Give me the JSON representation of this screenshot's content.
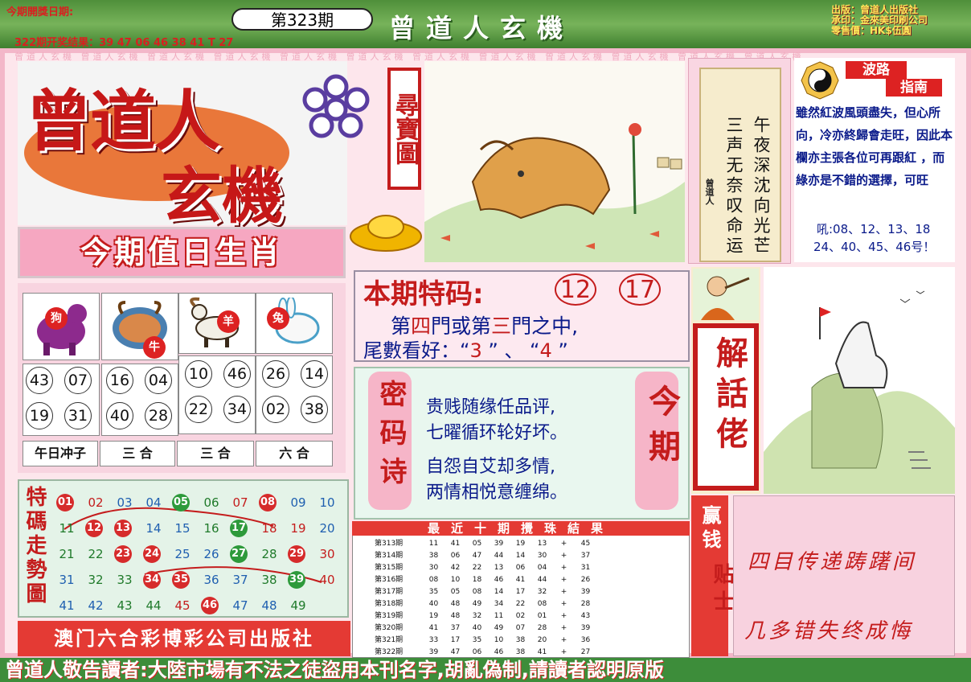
{
  "header": {
    "issue_date_label": "今期開獎日期:",
    "prev_result": "322期开奖结果：39 47 06 46 38 41 T 27",
    "issue_number": "第323期",
    "title": "曾道人玄機",
    "publisher_lines": [
      "出版：曾道人出版社",
      "承印：金來美印刷公司",
      "零售價：HK$伍圓"
    ]
  },
  "logo": {
    "main": "曾道人",
    "sub": "玄機",
    "side_tag": "尋寶圖"
  },
  "poem": {
    "col1": "午夜深沈向光芒",
    "col2": "三声无奈叹命运",
    "author": "曾道人"
  },
  "wave_guide": {
    "title1": "波路",
    "title2": "指南",
    "body": "雖然紅波風頭盡失，但心所向，冷亦終歸會走旺，因此本欄亦主張各位可再跟紅 ，而 綠亦是不錯的選擇，可旺",
    "nums1": "吼:08、12、13、18",
    "nums2": "24、40、45、46号！"
  },
  "zodiac": {
    "title": "今期值日生肖",
    "animals": [
      {
        "name": "狗",
        "numbers": [
          "43",
          "07",
          "19",
          "31"
        ],
        "label": "午日冲子"
      },
      {
        "name": "牛",
        "numbers": [
          "16",
          "04",
          "40",
          "28"
        ],
        "label": "三 合"
      },
      {
        "name": "羊",
        "numbers": [
          "10",
          "46",
          "22",
          "34"
        ],
        "label": "三 合"
      },
      {
        "name": "兔",
        "numbers": [
          "26",
          "14",
          "02",
          "38"
        ],
        "label": "六 合"
      }
    ]
  },
  "special": {
    "title": "本期特码:",
    "codes": [
      "12",
      "17"
    ],
    "line1_a": "第",
    "line1_b": "四",
    "line1_c": "門或第",
    "line1_d": "三",
    "line1_e": "門之中,",
    "line2_a": "尾數看好：“",
    "line2_b": "3",
    "line2_c": " ”  、 “",
    "line2_d": "4",
    "line2_e": " ”"
  },
  "secret_poem": {
    "label": "密码诗",
    "right_label": "今期",
    "lines": [
      "贵贱随缘任品评,",
      "七曜循环轮好坏。",
      "自怨自艾却多情,",
      "两情相悦意缠绵。"
    ]
  },
  "jiehua": {
    "label": "解話佬"
  },
  "tips": {
    "side_label": "赢钱",
    "side_label2": "贴士",
    "lines": [
      "四目传递踌躇间",
      "几多错失终成悔"
    ]
  },
  "trend": {
    "title": "特碼走勢圖",
    "rows": [
      [
        "01",
        "02",
        "03",
        "04",
        "05",
        "06",
        "07",
        "08",
        "09",
        "10"
      ],
      [
        "11",
        "12",
        "13",
        "14",
        "15",
        "16",
        "17",
        "18",
        "19",
        "20"
      ],
      [
        "21",
        "22",
        "23",
        "24",
        "25",
        "26",
        "27",
        "28",
        "29",
        "30"
      ],
      [
        "31",
        "32",
        "33",
        "34",
        "35",
        "36",
        "37",
        "38",
        "39",
        "40"
      ],
      [
        "41",
        "42",
        "43",
        "44",
        "45",
        "46",
        "47",
        "48",
        "49"
      ]
    ],
    "colors": {
      "01": "red",
      "02": "red",
      "03": "blue",
      "04": "blue",
      "05": "green",
      "06": "green",
      "07": "red",
      "08": "red",
      "09": "blue",
      "10": "blue",
      "11": "green",
      "12": "red",
      "13": "red",
      "14": "blue",
      "15": "blue",
      "16": "green",
      "17": "green",
      "18": "red",
      "19": "red",
      "20": "blue",
      "21": "green",
      "22": "green",
      "23": "red",
      "24": "red",
      "25": "blue",
      "26": "blue",
      "27": "green",
      "28": "green",
      "29": "red",
      "30": "red",
      "31": "blue",
      "32": "green",
      "33": "green",
      "34": "red",
      "35": "red",
      "36": "blue",
      "37": "blue",
      "38": "green",
      "39": "green",
      "40": "red",
      "41": "blue",
      "42": "blue",
      "43": "green",
      "44": "green",
      "45": "red",
      "46": "red",
      "47": "blue",
      "48": "blue",
      "49": "green"
    },
    "marked": [
      "01",
      "05",
      "08",
      "12",
      "13",
      "17",
      "23",
      "24",
      "27",
      "29",
      "34",
      "35",
      "39",
      "46"
    ],
    "press": "澳门六合彩博彩公司出版社"
  },
  "results": {
    "title": "最近十期攪珠結果",
    "rows": [
      [
        "第313期",
        "11",
        "41",
        "05",
        "39",
        "19",
        "13",
        "+",
        "45"
      ],
      [
        "第314期",
        "38",
        "06",
        "47",
        "44",
        "14",
        "30",
        "+",
        "37"
      ],
      [
        "第315期",
        "30",
        "42",
        "22",
        "13",
        "06",
        "04",
        "+",
        "31"
      ],
      [
        "第316期",
        "08",
        "10",
        "18",
        "46",
        "41",
        "44",
        "+",
        "26"
      ],
      [
        "第317期",
        "35",
        "05",
        "08",
        "14",
        "17",
        "32",
        "+",
        "39"
      ],
      [
        "第318期",
        "40",
        "48",
        "49",
        "34",
        "22",
        "08",
        "+",
        "28"
      ],
      [
        "第319期",
        "19",
        "48",
        "32",
        "11",
        "02",
        "01",
        "+",
        "43"
      ],
      [
        "第320期",
        "41",
        "37",
        "40",
        "49",
        "07",
        "28",
        "+",
        "39"
      ],
      [
        "第321期",
        "33",
        "17",
        "35",
        "10",
        "38",
        "20",
        "+",
        "36"
      ],
      [
        "第322期",
        "39",
        "47",
        "06",
        "46",
        "38",
        "41",
        "+",
        "27"
      ]
    ]
  },
  "footer": "曾道人敬告讀者:大陸市場有不法之徒盜用本刊名字,胡亂偽制,請讀者認明原版",
  "watermark": "曾道人玄機 曾道人玄機 曾道人玄機 曾道人玄機 曾道人玄機 曾道人玄機 曾道人玄機 曾道人玄機 曾道人玄機 曾道人玄機 曾道人玄機 曾道人玄機"
}
